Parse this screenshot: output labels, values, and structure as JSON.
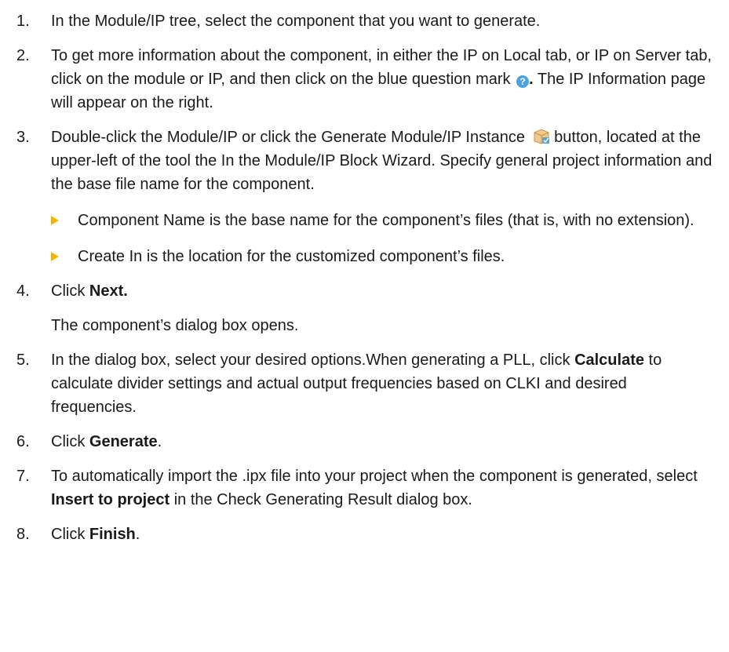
{
  "steps": [
    {
      "number": "1.",
      "text": "In the Module/IP tree, select the component that you want to generate."
    },
    {
      "number": "2.",
      "text_before": "To get more information about the component, in either the IP on Local tab, or IP on Server tab, click on the module or IP, and then click on the blue question mark ",
      "icon": "question-mark-icon",
      "text_after": " The IP Information page will appear on the right.",
      "icon_punct": "."
    },
    {
      "number": "3.",
      "text_before": "Double-click the Module/IP or click the Generate Module/IP Instance ",
      "icon": "generate-instance-icon",
      "text_after": " button, located at the upper-left of the tool the In the Module/IP Block Wizard. Specify general project information and the base file name for the component.",
      "bullets": [
        "Component Name is the base name for the component’s files (that is, with no extension).",
        "Create In is the location for the customized component’s files."
      ]
    },
    {
      "number": "4.",
      "prefix": "Click ",
      "bold": "Next.",
      "suffix": "",
      "para": "The component’s dialog box opens."
    },
    {
      "number": "5.",
      "prefix": "In the dialog box, select your desired options.When generating a PLL, click ",
      "bold": "Calculate",
      "suffix": " to calculate divider settings and actual output frequencies based on CLKI and desired frequencies."
    },
    {
      "number": "6.",
      "prefix": "Click ",
      "bold": "Generate",
      "suffix": "."
    },
    {
      "number": "7.",
      "prefix": "To automatically import the .ipx file into your project when the component is generated, select ",
      "bold": "Insert to project",
      "suffix": " in the Check Generating Result dialog box."
    },
    {
      "number": "8.",
      "prefix": "Click ",
      "bold": "Finish",
      "suffix": "."
    }
  ],
  "colors": {
    "bullet": "#f4b400",
    "question_icon": "#4aa3df"
  }
}
